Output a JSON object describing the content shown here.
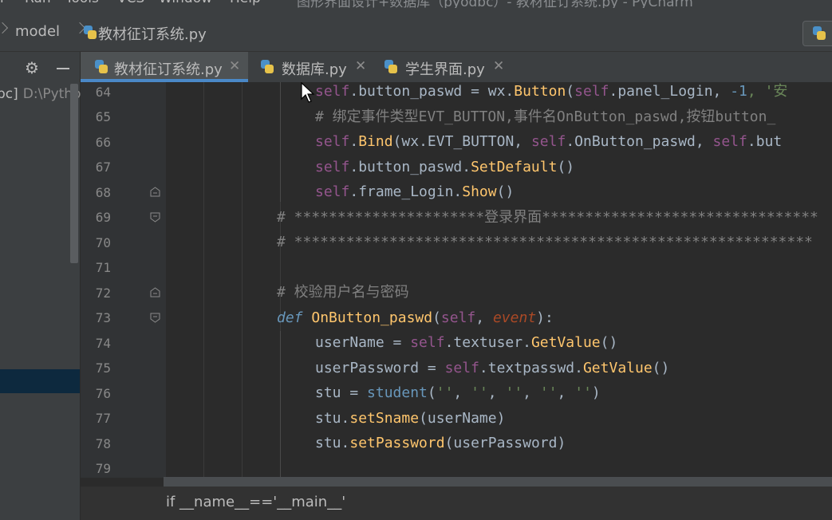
{
  "menu": {
    "items": [
      "r",
      "Run",
      "Tools",
      "VCS",
      "Window",
      "Help"
    ],
    "title": "图形界面设计+数据库（pyodbc）- 教材征订系统.py - PyCharm"
  },
  "navbar": {
    "breadcrumb": [
      "model",
      "教材征订系统.py"
    ]
  },
  "project": {
    "root_name": "bc]",
    "root_path": "D:\\Pytho"
  },
  "tabs": [
    {
      "label": "教材征订系统.py",
      "active": true
    },
    {
      "label": "数据库.py",
      "active": false
    },
    {
      "label": "学生界面.py",
      "active": false
    }
  ],
  "editor": {
    "line_numbers": [
      "64",
      "65",
      "66",
      "67",
      "68",
      "69",
      "70",
      "71",
      "72",
      "73",
      "74",
      "75",
      "76",
      "77",
      "78",
      "79"
    ],
    "code": {
      "l64": [
        "self",
        ".button_paswd = wx.",
        "Button",
        "(",
        "self",
        ".panel_Login, ",
        "-1",
        ", '安"
      ],
      "l65": "# 绑定事件类型EVT_BUTTON,事件名OnButton_paswd,按钮button_",
      "l66": [
        "self",
        ".",
        "Bind",
        "(wx.EVT_BUTTON, ",
        "self",
        ".OnButton_paswd, ",
        "self",
        ".but"
      ],
      "l67": [
        "self",
        ".button_paswd.",
        "SetDefault",
        "()"
      ],
      "l68": [
        "self",
        ".frame_Login.",
        "Show",
        "()"
      ],
      "l69": "# **********************登录界面********************************",
      "l70": "# ************************************************************",
      "l72": "# 校验用户名与密码",
      "l73": [
        "def",
        " ",
        "OnButton_paswd",
        "(",
        "self",
        ", ",
        "event",
        "):"
      ],
      "l74": [
        "userName = ",
        "self",
        ".textuser.",
        "GetValue",
        "()"
      ],
      "l75": [
        "userPassword = ",
        "self",
        ".textpasswd.",
        "GetValue",
        "()"
      ],
      "l76": [
        "stu = ",
        "student",
        "(",
        "''",
        ", ",
        "''",
        ", ",
        "''",
        ", ",
        "''",
        ", ",
        "''",
        ")"
      ],
      "l77": [
        "stu.",
        "setSname",
        "(userName)"
      ],
      "l78": [
        "stu.",
        "setPassword",
        "(userPassword)"
      ]
    }
  },
  "footer": {
    "breadcrumb": "if __name__=='__main__'"
  }
}
